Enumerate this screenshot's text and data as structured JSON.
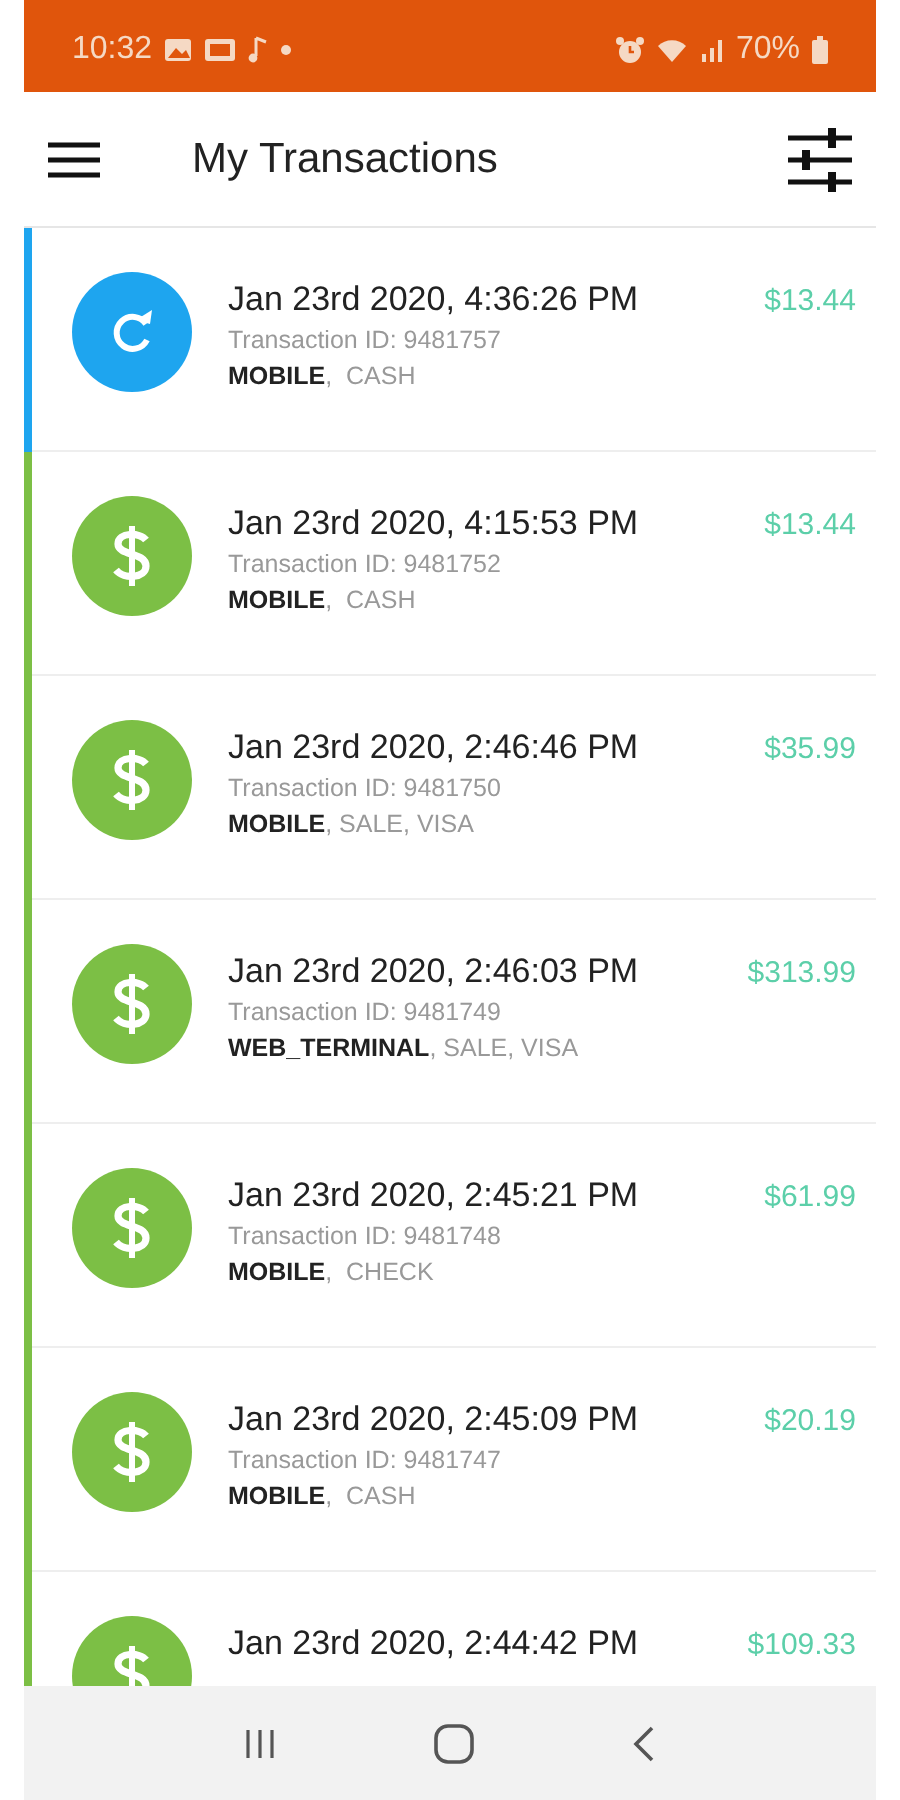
{
  "status_bar": {
    "time": "10:32",
    "battery": "70%"
  },
  "app_bar": {
    "title": "My Transactions"
  },
  "transactions": [
    {
      "kind": "refund",
      "color": "#1ea5ef",
      "date": "Jan 23rd 2020, 4:36:26 PM",
      "id": "Transaction ID: 9481757",
      "tags": "**MOBILE**,  CASH",
      "amount": "$13.44"
    },
    {
      "kind": "payment",
      "color": "#7cbf45",
      "date": "Jan 23rd 2020, 4:15:53 PM",
      "id": "Transaction ID: 9481752",
      "tags": "**MOBILE**,  CASH",
      "amount": "$13.44"
    },
    {
      "kind": "payment",
      "color": "#7cbf45",
      "date": "Jan 23rd 2020, 2:46:46 PM",
      "id": "Transaction ID: 9481750",
      "tags": "**MOBILE**, SALE, VISA",
      "amount": "$35.99"
    },
    {
      "kind": "payment",
      "color": "#7cbf45",
      "date": "Jan 23rd 2020, 2:46:03 PM",
      "id": "Transaction ID: 9481749",
      "tags": "**WEB_TERMINAL**, SALE, VISA",
      "amount": "$313.99"
    },
    {
      "kind": "payment",
      "color": "#7cbf45",
      "date": "Jan 23rd 2020, 2:45:21 PM",
      "id": "Transaction ID: 9481748",
      "tags": "**MOBILE**,  CHECK",
      "amount": "$61.99"
    },
    {
      "kind": "payment",
      "color": "#7cbf45",
      "date": "Jan 23rd 2020, 2:45:09 PM",
      "id": "Transaction ID: 9481747",
      "tags": "**MOBILE**,  CASH",
      "amount": "$20.19"
    },
    {
      "kind": "payment",
      "color": "#7cbf45",
      "date": "Jan 23rd 2020, 2:44:42 PM",
      "amount": "$109.33"
    }
  ]
}
